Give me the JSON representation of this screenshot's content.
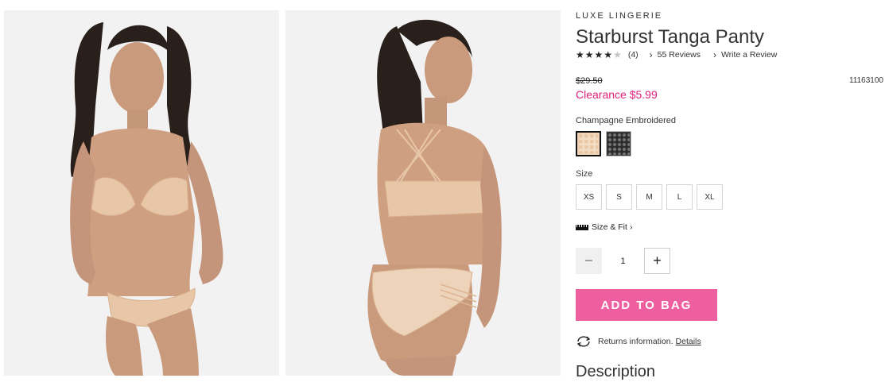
{
  "images": [
    {
      "name": "front-model-photo"
    },
    {
      "name": "back-model-photo"
    }
  ],
  "product": {
    "brand": "LUXE LINGERIE",
    "title": "Starburst Tanga Panty",
    "rating": 4,
    "rating_max": 5,
    "rating_count": "(4)",
    "reviews_link": "55 Reviews",
    "write_review_link": "Write a Review",
    "old_price": "$29.50",
    "sku": "11163100",
    "clearance_price": "Clearance $5.99",
    "color_label": "Champagne Embroidered",
    "swatches": [
      {
        "name": "champagne",
        "color": "#f2d5b8",
        "selected": true
      },
      {
        "name": "black",
        "color": "#2b2b2b",
        "selected": false
      }
    ],
    "size_label": "Size",
    "sizes": [
      "XS",
      "S",
      "M",
      "L",
      "XL"
    ],
    "size_fit_link": "Size & Fit",
    "quantity": "1",
    "add_to_bag": "ADD TO BAG",
    "returns_text": "Returns information.",
    "details_link": "Details",
    "description_heading": "Description"
  },
  "colors": {
    "accent": "#ee5fa0",
    "clearance": "#e01f78"
  }
}
